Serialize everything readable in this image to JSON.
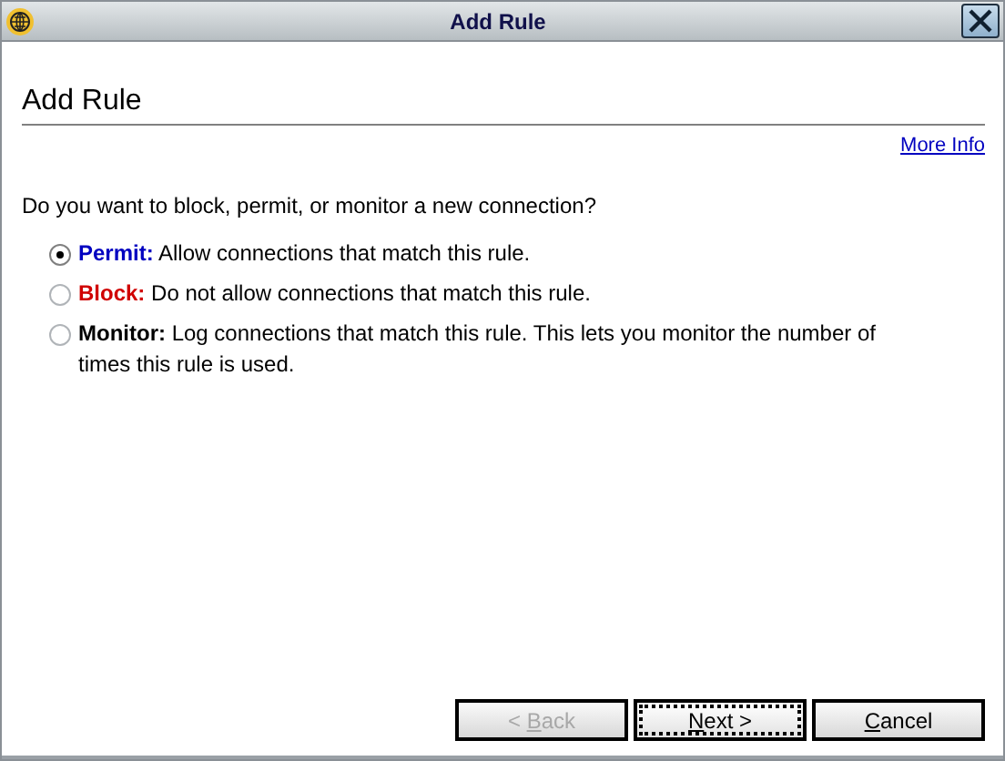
{
  "window": {
    "title": "Add Rule"
  },
  "heading": "Add Rule",
  "more_info": "More Info",
  "question": "Do you want to block, permit, or monitor a new connection?",
  "options": [
    {
      "text": "**Permit:** Allow connections that match this rule.",
      "color": "#0000c0",
      "selected": true
    },
    {
      "text": "**Block:** Do not allow connections that match this rule.",
      "color": "#d00000",
      "selected": false
    },
    {
      "text": "**Monitor:** Log connections that match this rule. This lets you monitor the number of times this rule is used.",
      "color": "#000000",
      "selected": false
    }
  ],
  "buttons": [
    {
      "before": "< ",
      "key": "B",
      "after": "ack",
      "disabled": true,
      "focused": false
    },
    {
      "key": "N",
      "after": "ext >",
      "disabled": false,
      "focused": true
    },
    {
      "key": "C",
      "after": "ancel",
      "disabled": false,
      "focused": false
    }
  ]
}
